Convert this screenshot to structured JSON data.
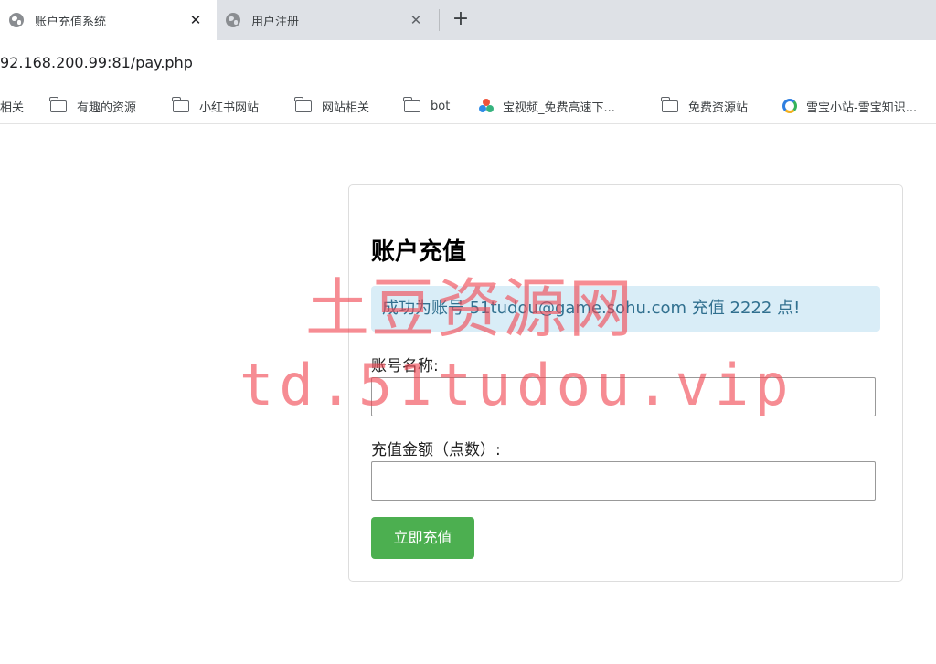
{
  "browser": {
    "tabs": [
      {
        "title": "账户充值系统",
        "active": true
      },
      {
        "title": "用户注册",
        "active": false
      }
    ],
    "new_tab_label": "+",
    "close_glyph": "✕",
    "url": "92.168.200.99:81/pay.php"
  },
  "bookmarks": [
    {
      "label": "相关",
      "icon": "none"
    },
    {
      "label": "有趣的资源",
      "icon": "folder-icon"
    },
    {
      "label": "小红书网站",
      "icon": "folder-icon"
    },
    {
      "label": "网站相关",
      "icon": "folder-icon"
    },
    {
      "label": "bot",
      "icon": "folder-icon"
    },
    {
      "label": "宝视频_免费高速下...",
      "icon": "video-icon"
    },
    {
      "label": "免费资源站",
      "icon": "folder-icon"
    },
    {
      "label": "雪宝小站-雪宝知识...",
      "icon": "site-icon"
    }
  ],
  "form": {
    "title": "账户充值",
    "alert": "成功为账号 51tudou@game.sohu.com 充值 2222 点!",
    "account_label": "账号名称:",
    "account_value": "",
    "amount_label": "充值金额（点数）:",
    "amount_value": "",
    "submit_label": "立即充值"
  },
  "watermark": {
    "line1": "土豆资源网",
    "line2": "td.51tudou.vip"
  },
  "colors": {
    "alert_bg": "#d9edf7",
    "alert_text": "#31708f",
    "button_bg": "#4caf50",
    "watermark": "#f04650"
  }
}
